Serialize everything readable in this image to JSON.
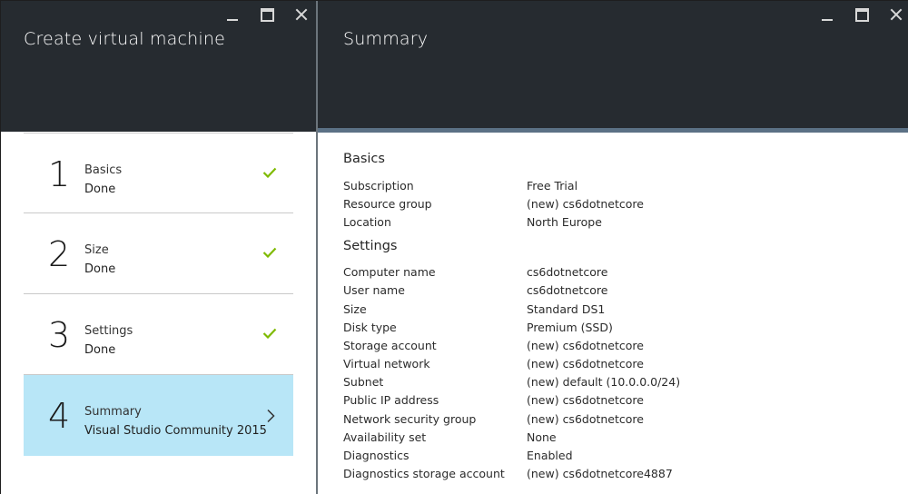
{
  "left_blade": {
    "title": "Create virtual machine",
    "steps": [
      {
        "number": "1",
        "label": "Basics",
        "status": "Done",
        "icon": "check-icon"
      },
      {
        "number": "2",
        "label": "Size",
        "status": "Done",
        "icon": "check-icon"
      },
      {
        "number": "3",
        "label": "Settings",
        "status": "Done",
        "icon": "check-icon"
      },
      {
        "number": "4",
        "label": "Summary",
        "status": "Visual Studio Community 2015 ...",
        "icon": "chevron-right-icon"
      }
    ]
  },
  "right_blade": {
    "title": "Summary",
    "sections": [
      {
        "title": "Basics",
        "rows": [
          {
            "key": "Subscription",
            "value": "Free Trial"
          },
          {
            "key": "Resource group",
            "value": "(new) cs6dotnetcore"
          },
          {
            "key": "Location",
            "value": "North Europe"
          }
        ]
      },
      {
        "title": "Settings",
        "rows": [
          {
            "key": "Computer name",
            "value": "cs6dotnetcore"
          },
          {
            "key": "User name",
            "value": "cs6dotnetcore"
          },
          {
            "key": "Size",
            "value": "Standard DS1"
          },
          {
            "key": "Disk type",
            "value": "Premium (SSD)"
          },
          {
            "key": "Storage account",
            "value": "(new) cs6dotnetcore"
          },
          {
            "key": "Virtual network",
            "value": "(new) cs6dotnetcore"
          },
          {
            "key": "Subnet",
            "value": "(new) default (10.0.0.0/24)"
          },
          {
            "key": "Public IP address",
            "value": "(new) cs6dotnetcore"
          },
          {
            "key": "Network security group",
            "value": "(new) cs6dotnetcore"
          },
          {
            "key": "Availability set",
            "value": "None"
          },
          {
            "key": "Diagnostics",
            "value": "Enabled"
          },
          {
            "key": "Diagnostics storage account",
            "value": "(new) cs6dotnetcore4887"
          }
        ]
      }
    ]
  },
  "colors": {
    "header_bg": "#262b30",
    "active_step_bg": "#b8e6f7",
    "check_green": "#7fba00",
    "accent_bar": "#5b7185"
  }
}
